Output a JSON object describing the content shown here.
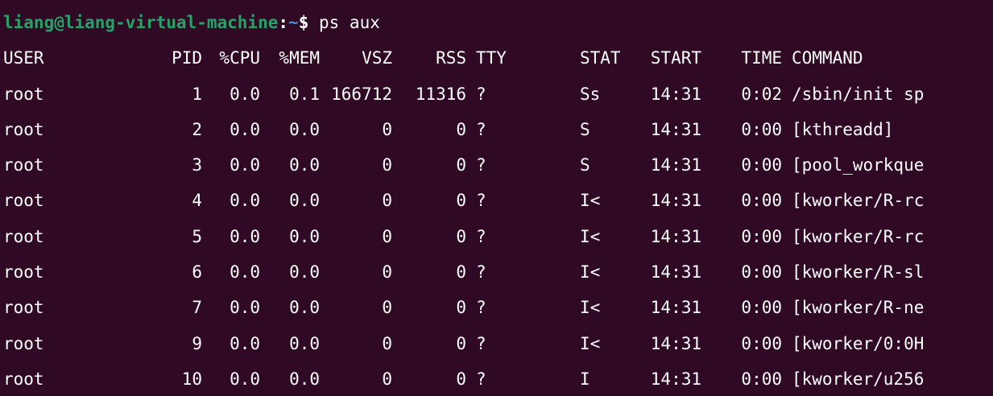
{
  "prompt": {
    "user_host": "liang@liang-virtual-machine",
    "separator": ":",
    "path": "~",
    "dollar": "$",
    "command": "ps aux"
  },
  "table": {
    "headers": [
      "USER",
      "PID",
      "%CPU",
      "%MEM",
      "VSZ",
      "RSS",
      "TTY",
      "STAT",
      "START",
      "TIME",
      "COMMAND"
    ],
    "rows": [
      [
        "root",
        "1",
        "0.0",
        "0.1",
        "166712",
        "11316",
        "?",
        "Ss",
        "14:31",
        "0:02",
        "/sbin/init sp"
      ],
      [
        "root",
        "2",
        "0.0",
        "0.0",
        "0",
        "0",
        "?",
        "S",
        "14:31",
        "0:00",
        "[kthreadd]"
      ],
      [
        "root",
        "3",
        "0.0",
        "0.0",
        "0",
        "0",
        "?",
        "S",
        "14:31",
        "0:00",
        "[pool_workque"
      ],
      [
        "root",
        "4",
        "0.0",
        "0.0",
        "0",
        "0",
        "?",
        "I<",
        "14:31",
        "0:00",
        "[kworker/R-rc"
      ],
      [
        "root",
        "5",
        "0.0",
        "0.0",
        "0",
        "0",
        "?",
        "I<",
        "14:31",
        "0:00",
        "[kworker/R-rc"
      ],
      [
        "root",
        "6",
        "0.0",
        "0.0",
        "0",
        "0",
        "?",
        "I<",
        "14:31",
        "0:00",
        "[kworker/R-sl"
      ],
      [
        "root",
        "7",
        "0.0",
        "0.0",
        "0",
        "0",
        "?",
        "I<",
        "14:31",
        "0:00",
        "[kworker/R-ne"
      ],
      [
        "root",
        "9",
        "0.0",
        "0.0",
        "0",
        "0",
        "?",
        "I<",
        "14:31",
        "0:00",
        "[kworker/0:0H"
      ],
      [
        "root",
        "10",
        "0.0",
        "0.0",
        "0",
        "0",
        "?",
        "I",
        "14:31",
        "0:00",
        "[kworker/u256"
      ]
    ]
  },
  "colors": {
    "background": "#300a24",
    "prompt_user": "#26a269",
    "prompt_path": "#3a8fd6",
    "text": "#ffffff"
  }
}
